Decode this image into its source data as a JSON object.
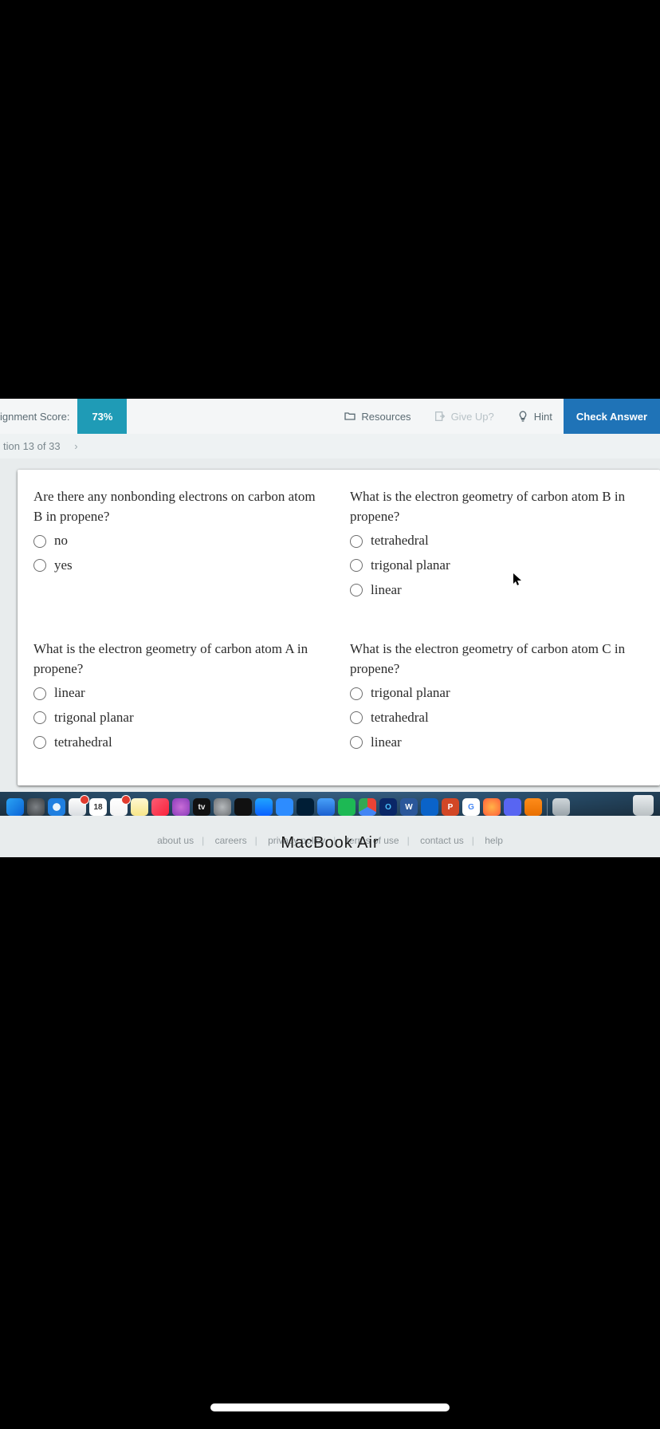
{
  "toolbar": {
    "score_label": "ignment Score:",
    "score_value": "73%",
    "resources": "Resources",
    "give_up": "Give Up?",
    "hint": "Hint",
    "check": "Check Answer"
  },
  "qnav": {
    "label": "tion 13 of 33",
    "chevron": "›"
  },
  "questions": [
    {
      "prompt": "Are there any nonbonding electrons on carbon atom B in propene?",
      "options": [
        "no",
        "yes"
      ]
    },
    {
      "prompt": "What is the electron geometry of carbon atom B in propene?",
      "options": [
        "tetrahedral",
        "trigonal planar",
        "linear"
      ]
    },
    {
      "prompt": "What is the electron geometry of carbon atom A in propene?",
      "options": [
        "linear",
        "trigonal planar",
        "tetrahedral"
      ]
    },
    {
      "prompt": "What is the electron geometry of carbon atom C in propene?",
      "options": [
        "trigonal planar",
        "tetrahedral",
        "linear"
      ]
    }
  ],
  "footer": [
    "about us",
    "careers",
    "privacy policy",
    "terms of use",
    "contact us",
    "help"
  ],
  "dock": {
    "icons": [
      {
        "name": "finder",
        "bg": "linear-gradient(135deg,#2aa3f4,#0b63d6)"
      },
      {
        "name": "launchpad",
        "bg": "radial-gradient(circle,#7d8185,#3d4144)"
      },
      {
        "name": "safari",
        "bg": "radial-gradient(circle,#e9f3fb 30%,#1f7fe0 32%)"
      },
      {
        "name": "mail",
        "bg": "linear-gradient(#fdfdfd,#d9dde1)",
        "badge": true
      },
      {
        "name": "calendar",
        "bg": "#fff",
        "text": "18",
        "text_color": "#333"
      },
      {
        "name": "reminders",
        "bg": "linear-gradient(#fff,#f3f3f3)",
        "badge": true
      },
      {
        "name": "notes",
        "bg": "linear-gradient(#fff7d1,#f7e68a)"
      },
      {
        "name": "music",
        "bg": "linear-gradient(135deg,#fb5c74,#fa233b)"
      },
      {
        "name": "podcasts",
        "bg": "radial-gradient(circle,#c86dd7,#8a3ab9)"
      },
      {
        "name": "appletv",
        "bg": "#111",
        "text": "tv",
        "text_color": "#eee"
      },
      {
        "name": "settings",
        "bg": "radial-gradient(circle,#b5b9bc,#6d7174)"
      },
      {
        "name": "stocks",
        "bg": "#111"
      },
      {
        "name": "appstore",
        "bg": "linear-gradient(#1fa4ff,#0a60ff)"
      },
      {
        "name": "zoom",
        "bg": "#2d8cff"
      },
      {
        "name": "photoshop",
        "bg": "#001e36"
      },
      {
        "name": "xcode",
        "bg": "linear-gradient(#48a0f8,#1a5fd0)"
      },
      {
        "name": "spotify",
        "bg": "#1db954"
      },
      {
        "name": "chrome",
        "bg": "conic-gradient(#ea4335 0 120deg,#4285f4 120deg 240deg,#34a853 240deg 360deg)"
      },
      {
        "name": "outlook",
        "bg": "#0a2767",
        "text": "O",
        "text_color": "#4cc2ff"
      },
      {
        "name": "word",
        "bg": "#2b579a",
        "text": "W",
        "text_color": "#fff"
      },
      {
        "name": "bluetooth",
        "bg": "#0a63c9"
      },
      {
        "name": "powerpoint",
        "bg": "#d24726",
        "text": "P",
        "text_color": "#fff"
      },
      {
        "name": "googledrive",
        "bg": "#fff",
        "text": "G",
        "text_color": "#4285f4"
      },
      {
        "name": "firefox",
        "bg": "radial-gradient(circle,#ffb347,#ff5e3a)"
      },
      {
        "name": "discord",
        "bg": "#5865f2"
      },
      {
        "name": "vlc",
        "bg": "linear-gradient(#ff8c1a,#e86f00)"
      }
    ],
    "trash": {
      "name": "trash",
      "bg": "linear-gradient(#e9edef,#b9c0c3)"
    }
  },
  "device_label": "MacBook Air"
}
